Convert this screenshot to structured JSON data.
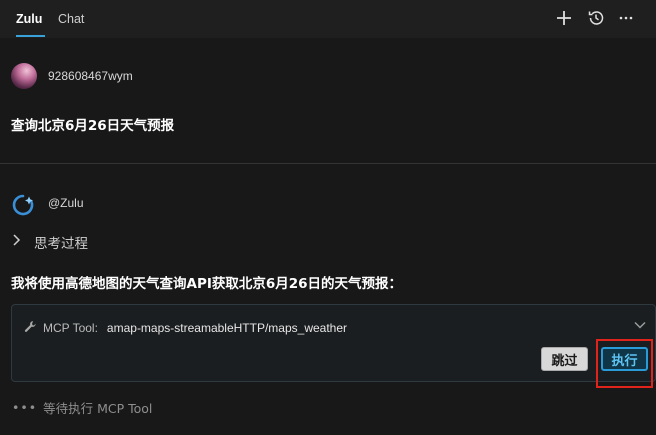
{
  "header": {
    "tabs": [
      {
        "label": "Zulu",
        "active": true
      },
      {
        "label": "Chat",
        "active": false
      }
    ],
    "icons": [
      "plus-icon",
      "history-icon",
      "more-icon"
    ]
  },
  "user_message": {
    "username": "928608467wym",
    "text": "查询北京6月26日天气预报"
  },
  "assistant_message": {
    "name": "@Zulu",
    "thinking_label": "思考过程",
    "text": "我将使用高德地图的天气查询API获取北京6月26日的天气预报：",
    "tool_card": {
      "label": "MCP Tool:",
      "tool_name": "amap-maps-streamableHTTP/maps_weather",
      "skip_label": "跳过",
      "execute_label": "执行"
    },
    "status": {
      "dots": "•••",
      "text": "等待执行 MCP Tool"
    }
  },
  "colors": {
    "background": "#181818",
    "accent": "#3aa1d8",
    "highlight_box": "#e0241b"
  }
}
